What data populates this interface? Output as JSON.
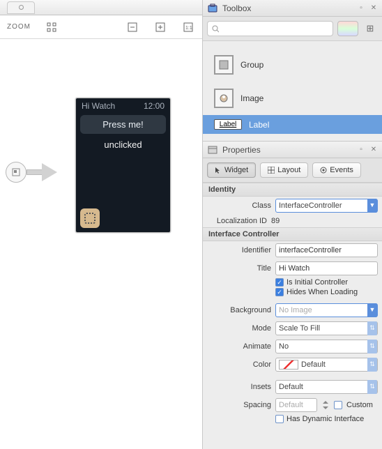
{
  "toolbar": {
    "zoom_label": "ZOOM"
  },
  "watch": {
    "title": "Hi Watch",
    "time": "12:00",
    "button_label": "Press me!",
    "label_text": "unclicked"
  },
  "toolbox": {
    "title": "Toolbox",
    "search_placeholder": "",
    "items": [
      {
        "label": "Group"
      },
      {
        "label": "Image"
      },
      {
        "label": "Label",
        "selected": true,
        "icon_text": "Label"
      }
    ]
  },
  "properties": {
    "title": "Properties",
    "tabs": {
      "widget": "Widget",
      "layout": "Layout",
      "events": "Events"
    },
    "sections": {
      "identity": {
        "header": "Identity",
        "class_label": "Class",
        "class_value": "InterfaceController",
        "locid_label": "Localization ID",
        "locid_value": "89"
      },
      "controller": {
        "header": "Interface Controller",
        "identifier_label": "Identifier",
        "identifier_value": "interfaceController",
        "title_label": "Title",
        "title_value": "Hi Watch",
        "is_initial": "Is Initial Controller",
        "hides": "Hides When Loading",
        "background_label": "Background",
        "background_value": "No Image",
        "mode_label": "Mode",
        "mode_value": "Scale To Fill",
        "animate_label": "Animate",
        "animate_value": "No",
        "color_label": "Color",
        "color_value": "Default",
        "insets_label": "Insets",
        "insets_value": "Default",
        "spacing_label": "Spacing",
        "spacing_value": "Default",
        "custom_label": "Custom",
        "dynamic_label": "Has Dynamic Interface"
      }
    }
  }
}
